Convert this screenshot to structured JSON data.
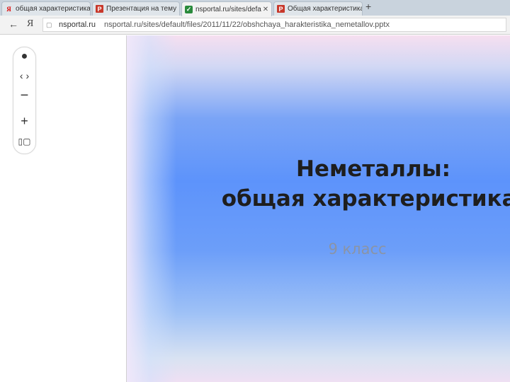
{
  "tabs": [
    {
      "label": "общая характеристика",
      "icon": "yandex-icon",
      "active": false
    },
    {
      "label": "Презентация на тему",
      "icon": "powerpoint-icon",
      "active": false
    },
    {
      "label": "nsportal.ru/sites/defa...",
      "icon": "nsportal-icon",
      "active": true
    },
    {
      "label": "Общая характеристика",
      "icon": "powerpoint-icon",
      "active": false
    }
  ],
  "toolbar": {
    "yandex_glyph": "Я",
    "url_domain": "nsportal.ru",
    "url_path": "nsportal.ru/sites/default/files/2011/11/22/obshchaya_harakteristika_nemetallov.pptx"
  },
  "slide": {
    "title_line1": "Неметаллы:",
    "title_line2": "общая характеристика.",
    "subtitle": "9 класс"
  },
  "colors": {
    "slide_blue": "#5d93fb",
    "title_text": "#1e1e1e",
    "subtitle_text": "#8a94a6"
  }
}
